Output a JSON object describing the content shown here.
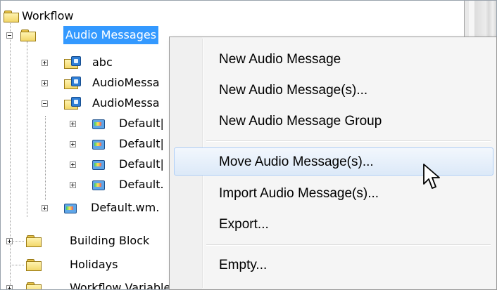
{
  "tree": {
    "nodes": [
      {
        "id": "workflow",
        "label": "Workflow",
        "icon": "folder-open-icon"
      },
      {
        "id": "audio-messages",
        "label": "Audio Messages",
        "icon": "folder-open-icon",
        "selected": true
      },
      {
        "id": "abc",
        "label": "abc",
        "icon": "message-group-icon"
      },
      {
        "id": "audiomessa-1",
        "label": "AudioMessa",
        "icon": "message-group-icon"
      },
      {
        "id": "audiomessa-2",
        "label": "AudioMessa",
        "icon": "message-group-icon"
      },
      {
        "id": "default-1",
        "label": "Default|",
        "icon": "audio-message-icon"
      },
      {
        "id": "default-2",
        "label": "Default|",
        "icon": "audio-message-icon"
      },
      {
        "id": "default-3",
        "label": "Default|",
        "icon": "audio-message-icon"
      },
      {
        "id": "default-4",
        "label": "Default.",
        "icon": "audio-message-icon"
      },
      {
        "id": "default-wm",
        "label": "Default.wm.",
        "icon": "audio-message-icon"
      },
      {
        "id": "building-block",
        "label": "Building Block",
        "icon": "folder-icon"
      },
      {
        "id": "holidays",
        "label": "Holidays",
        "icon": "folder-icon"
      },
      {
        "id": "workflow-variables",
        "label": "Workflow Variables",
        "icon": "folder-icon"
      }
    ]
  },
  "context_menu": {
    "items": [
      {
        "id": "new-audio-message",
        "label": "New Audio Message"
      },
      {
        "id": "new-audio-messages",
        "label": "New Audio Message(s)..."
      },
      {
        "id": "new-audio-message-group",
        "label": "New Audio Message Group"
      },
      {
        "id": "move-audio-messages",
        "label": "Move Audio Message(s)...",
        "hovered": true
      },
      {
        "id": "import-audio-messages",
        "label": "Import Audio Message(s)..."
      },
      {
        "id": "export",
        "label": "Export..."
      },
      {
        "id": "empty",
        "label": "Empty..."
      }
    ]
  },
  "colors": {
    "selection": "#3399ff",
    "menu_background": "#f5f5f5",
    "hover_border": "#aecef7"
  }
}
